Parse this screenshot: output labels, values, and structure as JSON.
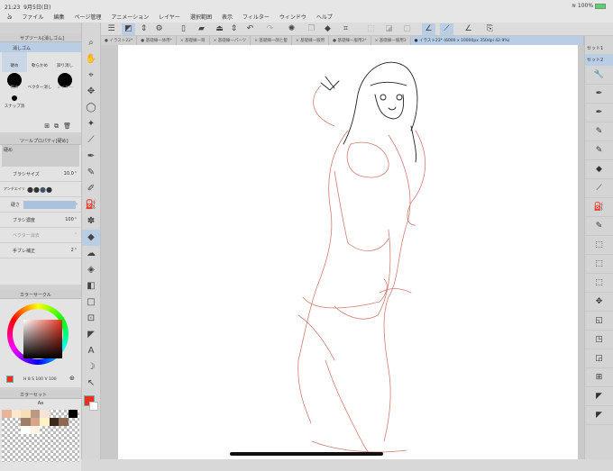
{
  "status": {
    "time": "21:23",
    "date": "9月5日(日)",
    "battery": "100%"
  },
  "menu": [
    "ファイル",
    "編集",
    "ページ管理",
    "アニメーション",
    "レイヤー",
    "選択範囲",
    "表示",
    "フィルター",
    "ウィンドウ",
    "ヘルプ"
  ],
  "tabs": [
    {
      "label": "● イラスト22*",
      "active": false
    },
    {
      "label": "● 基礎練一体用*",
      "active": false
    },
    {
      "label": "× 基礎練一目",
      "active": false
    },
    {
      "label": "× 基礎練一パーツ",
      "active": false
    },
    {
      "label": "× 基礎練一顔と髪",
      "active": false
    },
    {
      "label": "× 基礎練一服用",
      "active": false
    },
    {
      "label": "● 基礎練一服用2*",
      "active": false
    },
    {
      "label": "× 基礎練一服用3",
      "active": false
    },
    {
      "label": "● イラスト23* (6000 x 10000px 350dpi 42.9%)",
      "active": true
    }
  ],
  "subtool": {
    "title": "サブツール[消しゴム]",
    "group": "消しゴム",
    "items": [
      "硬め",
      "軟らかめ",
      "諦り消し",
      "粗め",
      "ベクター消し",
      "レイヤー",
      "スナップ消"
    ]
  },
  "toolprop": {
    "title": "ツールプロパティ[硬め]",
    "preview_label": "硬め",
    "brush_size_label": "ブラシサイズ",
    "brush_size": "10.0",
    "antialias_label": "アンチエイリ",
    "hardness_label": "硬さ",
    "density_label": "ブラシ濃度",
    "density": "100",
    "vector_label": "ベクター消去",
    "stabilization_label": "手ブレ補正",
    "stabilization": "2"
  },
  "colorcircle": {
    "title": "カラーサークル",
    "h": "8",
    "s": "100",
    "v": "100",
    "main_color": "#e8321e"
  },
  "colorset": {
    "title": "カラーセット",
    "set_name": "Aa"
  },
  "right": {
    "set1": "セット1",
    "set2": "セット2"
  }
}
